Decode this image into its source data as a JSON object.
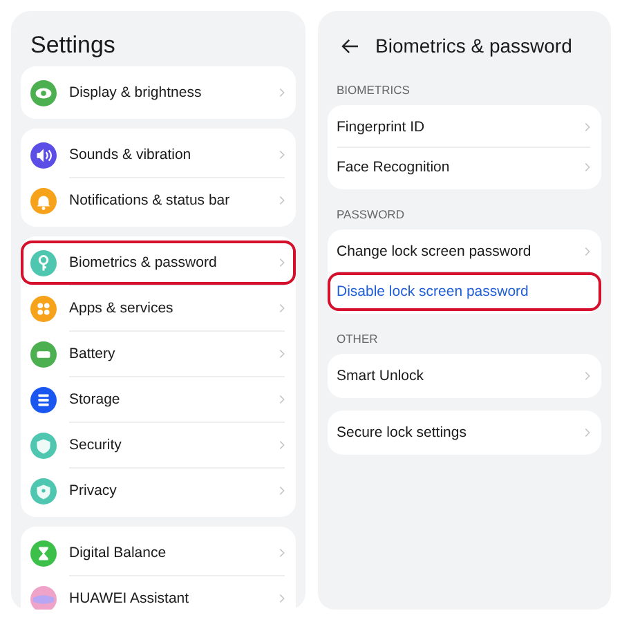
{
  "settings_panel": {
    "title": "Settings",
    "groups": [
      [
        {
          "label": "Display & brightness",
          "color": "#4caf50",
          "highlighted": false
        }
      ],
      [
        {
          "label": "Sounds & vibration",
          "color": "#5b4ee6",
          "highlighted": false
        },
        {
          "label": "Notifications & status bar",
          "color": "#f7a21b",
          "highlighted": false
        }
      ],
      [
        {
          "label": "Biometrics & password",
          "color": "#4fc6b0",
          "highlighted": true
        },
        {
          "label": "Apps & services",
          "color": "#f7a21b",
          "highlighted": false
        },
        {
          "label": "Battery",
          "color": "#4caf50",
          "highlighted": false
        },
        {
          "label": "Storage",
          "color": "#1a56f0",
          "highlighted": false
        },
        {
          "label": "Security",
          "color": "#4fc6b0",
          "highlighted": false
        },
        {
          "label": "Privacy",
          "color": "#4fc6b0",
          "highlighted": false
        }
      ],
      [
        {
          "label": "Digital Balance",
          "color": "#3cc04a",
          "highlighted": false
        },
        {
          "label": "HUAWEI Assistant",
          "color": "#f0a3c8",
          "highlighted": false
        }
      ]
    ]
  },
  "biometrics_panel": {
    "title": "Biometrics & password",
    "sections": [
      {
        "header": "BIOMETRICS",
        "groups": [
          [
            {
              "label": "Fingerprint ID",
              "kind": "nav",
              "highlighted": false
            },
            {
              "label": "Face Recognition",
              "kind": "nav",
              "highlighted": false
            }
          ]
        ]
      },
      {
        "header": "PASSWORD",
        "groups": [
          [
            {
              "label": "Change lock screen password",
              "kind": "nav",
              "highlighted": false
            },
            {
              "label": "Disable lock screen password",
              "kind": "action",
              "highlighted": true
            }
          ]
        ]
      },
      {
        "header": "OTHER",
        "groups": [
          [
            {
              "label": "Smart Unlock",
              "kind": "nav",
              "highlighted": false
            }
          ],
          [
            {
              "label": "Secure lock settings",
              "kind": "nav",
              "highlighted": false
            }
          ]
        ]
      }
    ]
  }
}
